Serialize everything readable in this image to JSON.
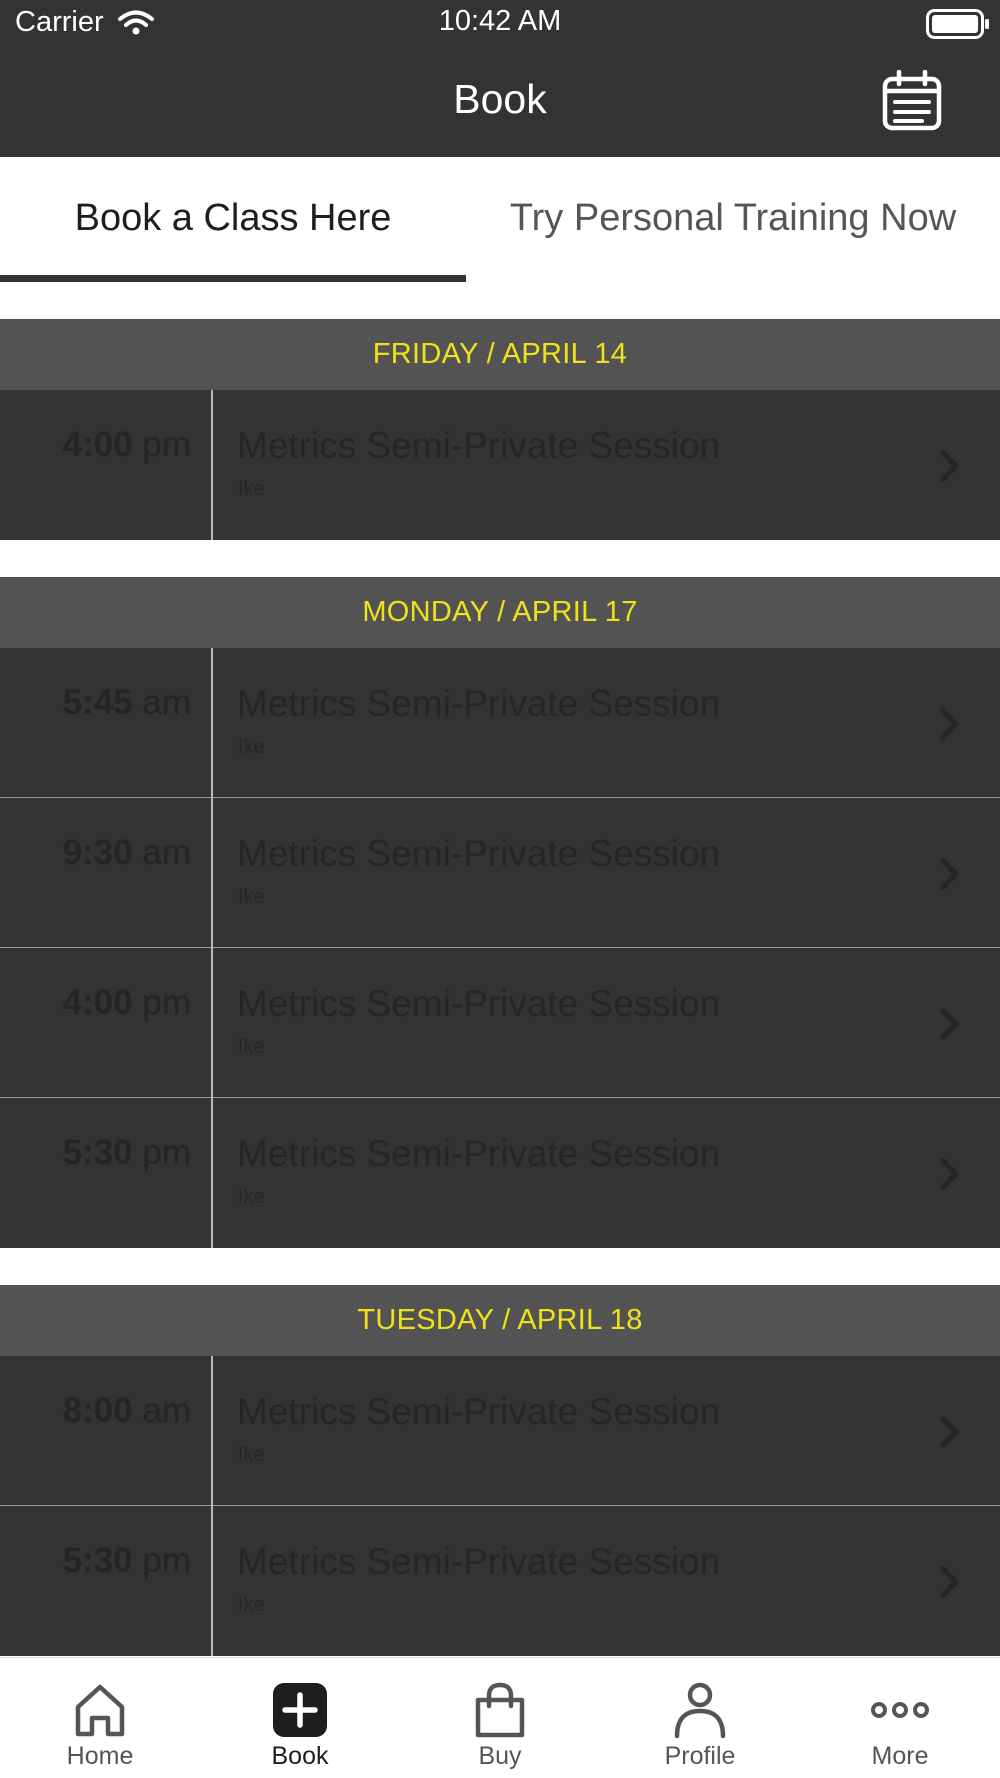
{
  "status_bar": {
    "carrier": "Carrier",
    "time": "10:42 AM"
  },
  "nav": {
    "title": "Book",
    "calendar_icon": "calendar-icon"
  },
  "tabs": [
    {
      "label": "Book a Class Here",
      "active": true
    },
    {
      "label": "Try Personal Training Now",
      "active": false
    }
  ],
  "colors": {
    "header_bg": "#333333",
    "section_bg": "#535353",
    "section_text": "#f0e21a",
    "row_bg": "#333333"
  },
  "sections": [
    {
      "date": "FRIDAY / APRIL 14",
      "sessions": [
        {
          "time": "4:00",
          "period": "pm",
          "name": "Metrics Semi-Private Session",
          "instructor": "Ike"
        }
      ]
    },
    {
      "date": "MONDAY / APRIL 17",
      "sessions": [
        {
          "time": "5:45",
          "period": "am",
          "name": "Metrics Semi-Private Session",
          "instructor": "Ike"
        },
        {
          "time": "9:30",
          "period": "am",
          "name": "Metrics Semi-Private Session",
          "instructor": "Ike"
        },
        {
          "time": "4:00",
          "period": "pm",
          "name": "Metrics Semi-Private Session",
          "instructor": "Ike"
        },
        {
          "time": "5:30",
          "period": "pm",
          "name": "Metrics Semi-Private Session",
          "instructor": "Ike"
        }
      ]
    },
    {
      "date": "TUESDAY / APRIL 18",
      "sessions": [
        {
          "time": "8:00",
          "period": "am",
          "name": "Metrics Semi-Private Session",
          "instructor": "Ike"
        },
        {
          "time": "5:30",
          "period": "pm",
          "name": "Metrics Semi-Private Session",
          "instructor": "Ike"
        }
      ]
    }
  ],
  "tab_bar": [
    {
      "label": "Home",
      "icon": "home-icon",
      "selected": false
    },
    {
      "label": "Book",
      "icon": "plus-icon",
      "selected": true
    },
    {
      "label": "Buy",
      "icon": "shopping-bag-icon",
      "selected": false
    },
    {
      "label": "Profile",
      "icon": "person-icon",
      "selected": false
    },
    {
      "label": "More",
      "icon": "more-icon",
      "selected": false
    }
  ]
}
